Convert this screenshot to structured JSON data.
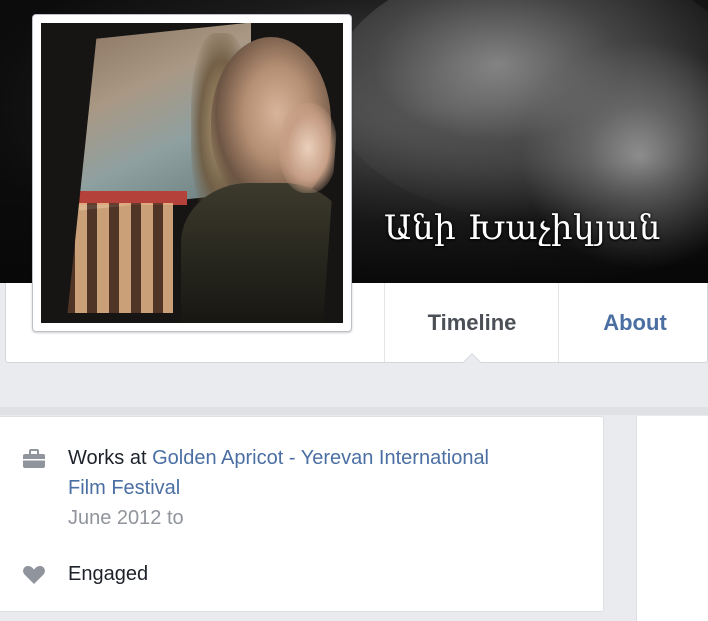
{
  "cover": {
    "name": "Անի Խաչիկյան"
  },
  "tabs": {
    "timeline": "Timeline",
    "about": "About"
  },
  "intro": {
    "work": {
      "prefix": "Works at",
      "employer_line1": "Golden Apricot - Yerevan International",
      "employer_line2": "Film Festival",
      "period": "June 2012 to",
      "icon": "briefcase-icon"
    },
    "relationship": {
      "status": "Engaged",
      "icon": "heart-icon"
    }
  },
  "colors": {
    "link": "#4b6fa3",
    "muted": "#90949c",
    "text": "#1d2129",
    "icon": "#90949c"
  }
}
